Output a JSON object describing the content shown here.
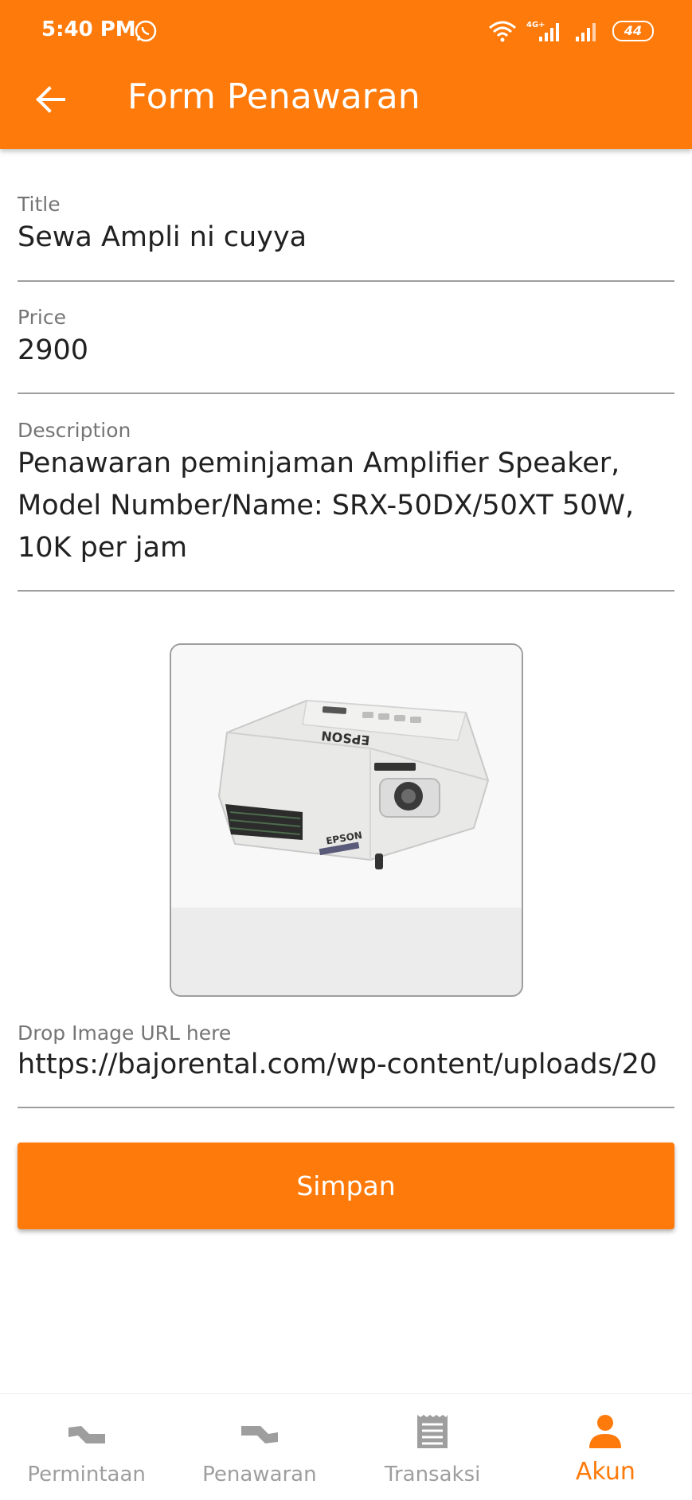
{
  "status_bar": {
    "time": "5:40 PM",
    "network": "4G+",
    "battery": "44"
  },
  "app_bar": {
    "title": "Form Penawaran"
  },
  "form": {
    "title_label": "Title",
    "title_value": "Sewa Ampli ni cuyya",
    "price_label": "Price",
    "price_value": "2900",
    "description_label": "Description",
    "description_value": "Penawaran peminjaman Amplifier Speaker, Model Number/Name: SRX-50DX/50XT 50W, 10K per jam",
    "image_url_label": "Drop Image URL here",
    "image_url_value": "https://bajorental.com/wp-content/uploads/20",
    "image_brand_text": "EPSON"
  },
  "save_label": "Simpan",
  "bottom_nav": {
    "items": [
      {
        "label": "Permintaan",
        "icon": "permintaan-icon"
      },
      {
        "label": "Penawaran",
        "icon": "penawaran-icon"
      },
      {
        "label": "Transaksi",
        "icon": "receipt-icon"
      },
      {
        "label": "Akun",
        "icon": "person-icon"
      }
    ],
    "active": "Akun"
  },
  "colors": {
    "accent": "#fe7a0a",
    "inactive": "#9e9e9e"
  }
}
